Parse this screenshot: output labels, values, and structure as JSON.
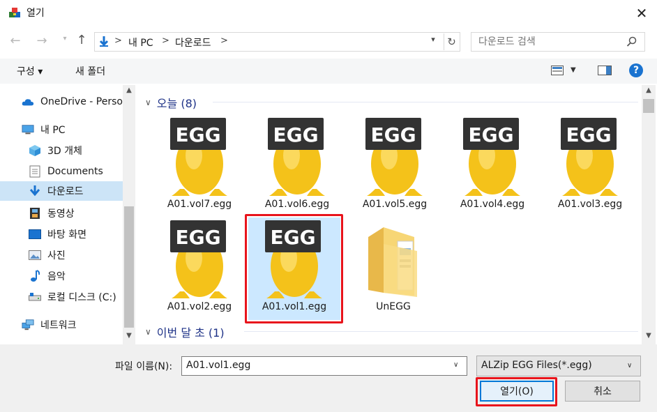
{
  "window": {
    "title": "열기"
  },
  "address": {
    "crumbs": [
      "내 PC",
      "다운로드"
    ],
    "separator": ">"
  },
  "search": {
    "placeholder": "다운로드 검색"
  },
  "toolbar": {
    "organize_label": "구성 ▾",
    "new_folder_label": "새 폴더"
  },
  "sidebar": {
    "items": [
      {
        "label": "OneDrive - Person",
        "icon": "onedrive-cloud-icon"
      },
      {
        "label": "내 PC",
        "icon": "computer-icon"
      },
      {
        "label": "3D 개체",
        "icon": "3d-objects-icon"
      },
      {
        "label": "Documents",
        "icon": "document-icon"
      },
      {
        "label": "다운로드",
        "icon": "download-arrow-icon",
        "selected": true
      },
      {
        "label": "동영상",
        "icon": "video-film-icon"
      },
      {
        "label": "바탕 화면",
        "icon": "desktop-icon"
      },
      {
        "label": "사진",
        "icon": "picture-icon"
      },
      {
        "label": "음악",
        "icon": "music-note-icon"
      },
      {
        "label": "로컬 디스크 (C:)",
        "icon": "local-disk-icon"
      },
      {
        "label": "네트워크",
        "icon": "network-icon"
      }
    ]
  },
  "groups": [
    {
      "label": "오늘 (8)"
    },
    {
      "label": "이번 달 초 (1)"
    }
  ],
  "files": [
    {
      "name": "A01.vol7.egg",
      "type": "egg"
    },
    {
      "name": "A01.vol6.egg",
      "type": "egg"
    },
    {
      "name": "A01.vol5.egg",
      "type": "egg"
    },
    {
      "name": "A01.vol4.egg",
      "type": "egg"
    },
    {
      "name": "A01.vol3.egg",
      "type": "egg"
    },
    {
      "name": "A01.vol2.egg",
      "type": "egg"
    },
    {
      "name": "A01.vol1.egg",
      "type": "egg",
      "selected": true
    },
    {
      "name": "UnEGG",
      "type": "folder"
    }
  ],
  "egg_badge_text": "EGG",
  "footer": {
    "filename_label": "파일 이름(N):",
    "filename_value": "A01.vol1.egg",
    "filetype_value": "ALZip EGG Files(*.egg)",
    "open_label": "열기(O)",
    "cancel_label": "취소"
  },
  "colors": {
    "accent_blue": "#0078d7",
    "selection": "#cce8ff",
    "highlight_red": "#e8141c",
    "egg_yellow": "#f4c21a",
    "folder_yellow": "#f7d675"
  }
}
